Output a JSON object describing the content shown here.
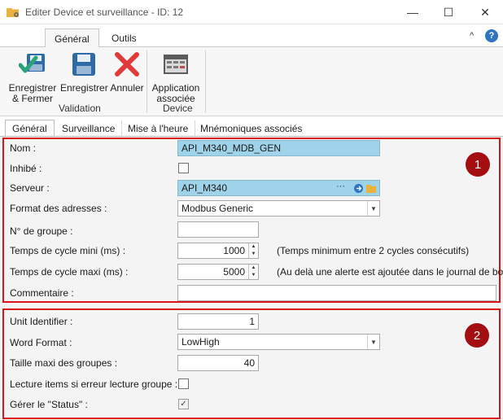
{
  "window": {
    "title": "Editer Device et surveillance - ID: 12",
    "minimize": "—",
    "maximize": "☐",
    "close": "✕"
  },
  "ribbon_tabs": [
    {
      "label": "Général"
    },
    {
      "label": "Outils"
    }
  ],
  "ribbon": {
    "save_close": [
      "Enregistrer",
      "& Fermer"
    ],
    "save": "Enregistrer",
    "cancel": "Annuler",
    "associated_app": [
      "Application",
      "associée"
    ],
    "group_validation": "Validation",
    "group_device": "Device",
    "help": "?",
    "collapse": "^"
  },
  "form_tabs": [
    "Général",
    "Surveillance",
    "Mise à l'heure",
    "Mnémoniques associés"
  ],
  "section1": {
    "badge": "1",
    "nom_label": "Nom :",
    "nom_value": "API_M340_MDB_GEN",
    "inhibe_label": "Inhibé :",
    "serveur_label": "Serveur :",
    "serveur_value": "API_M340",
    "format_label": "Format des adresses :",
    "format_value": "Modbus Generic",
    "groupe_label": "N° de groupe :",
    "groupe_value": "",
    "cycle_min_label": "Temps de cycle mini (ms) :",
    "cycle_min_value": "1000",
    "cycle_min_hint": "(Temps minimum entre 2 cycles consécutifs)",
    "cycle_max_label": "Temps de cycle maxi (ms) :",
    "cycle_max_value": "5000",
    "cycle_max_hint": "(Au delà une alerte est ajoutée dans le journal de bord)",
    "comment_label": "Commentaire :",
    "comment_value": ""
  },
  "section2": {
    "badge": "2",
    "unit_label": "Unit Identifier :",
    "unit_value": "1",
    "word_label": "Word Format :",
    "word_value": "LowHigh",
    "taille_label": "Taille maxi des groupes :",
    "taille_value": "40",
    "lecture_label": "Lecture items si erreur lecture groupe :",
    "status_label": "Gérer le \"Status\" :",
    "status_check": "✓"
  },
  "colors": {
    "highlight_field": "#9fd3e9",
    "annotation_red": "#d9141b",
    "badge_red": "#a50e10",
    "help_blue": "#2f74c0"
  }
}
